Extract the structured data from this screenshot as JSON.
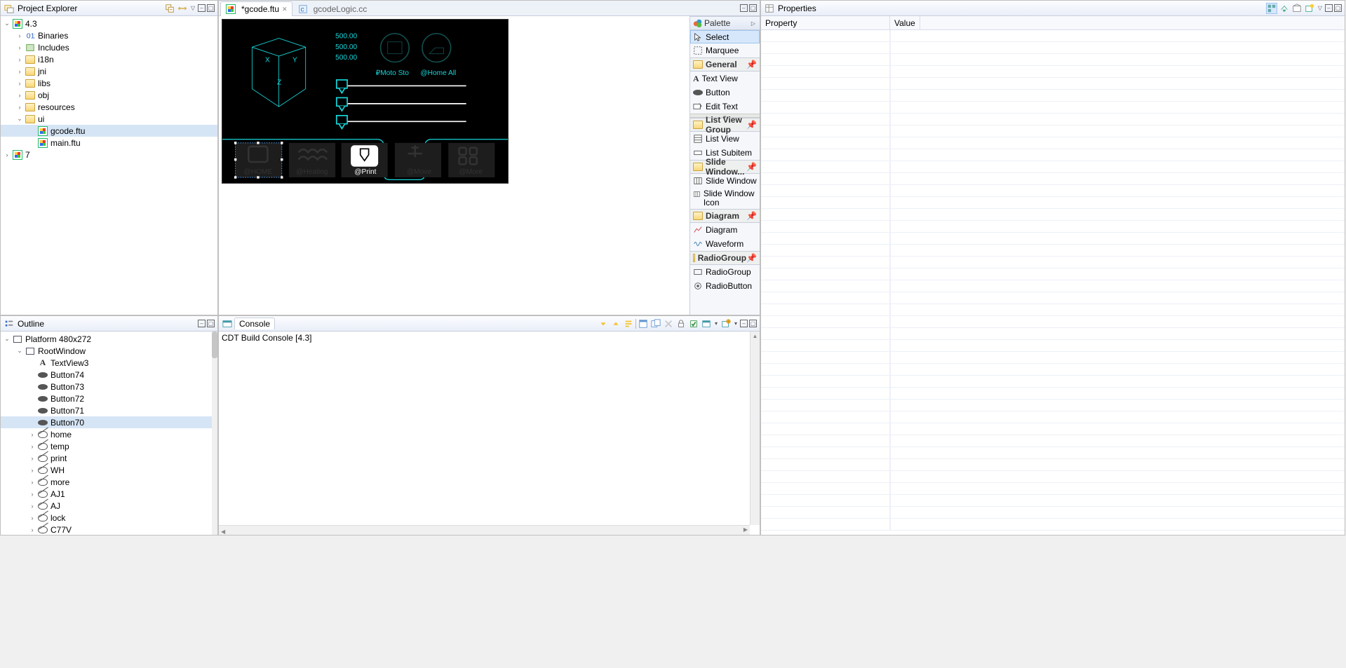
{
  "explorer": {
    "title": "Project Explorer",
    "nodes": {
      "root": "4.3",
      "binaries": "Binaries",
      "includes": "Includes",
      "i18n": "i18n",
      "jni": "jni",
      "libs": "libs",
      "obj": "obj",
      "resources": "resources",
      "ui": "ui",
      "gcode": "gcode.ftu",
      "main": "main.ftu",
      "seven": "7"
    }
  },
  "outline": {
    "title": "Outline",
    "platform": "Platform 480x272",
    "root": "RootWindow",
    "items": [
      "TextView3",
      "Button74",
      "Button73",
      "Button72",
      "Button71",
      "Button70",
      "home",
      "temp",
      "print",
      "WH",
      "more",
      "AJ1",
      "AJ",
      "lock",
      "C77V"
    ]
  },
  "editor": {
    "tabs": [
      {
        "label": "*gcode.ftu",
        "active": true
      },
      {
        "label": "gcodeLogic.cc",
        "active": false
      }
    ],
    "preview": {
      "val1": "500.00",
      "val2": "500.00",
      "val3": "500.00",
      "motorStop": "Moto Sto",
      "homeAll": "@Home All",
      "xLabel": "X",
      "yLabel": "Y",
      "zLabel": "Z",
      "btnHome": "@HOME",
      "btnHeating": "@Heating",
      "btnPrint": "@Print",
      "btnMove": "@Move",
      "btnMore": "@More"
    }
  },
  "palette": {
    "title": "Palette",
    "select": "Select",
    "marquee": "Marquee",
    "g_general": "General",
    "textview": "Text View",
    "button": "Button",
    "edittext": "Edit Text",
    "g_list": "List View Group",
    "listview": "List View",
    "listsub": "List Subitem",
    "g_slide": "Slide Window...",
    "slidewin": "Slide Window",
    "slideicon": "Slide Window Icon",
    "g_diagram": "Diagram",
    "diagram": "Diagram",
    "waveform": "Waveform",
    "g_radio": "RadioGroup",
    "radiogroup": "RadioGroup",
    "radiobutton": "RadioButton"
  },
  "properties": {
    "title": "Properties",
    "colProperty": "Property",
    "colValue": "Value"
  },
  "console": {
    "title": "Console",
    "text": "CDT Build Console [4.3]"
  }
}
